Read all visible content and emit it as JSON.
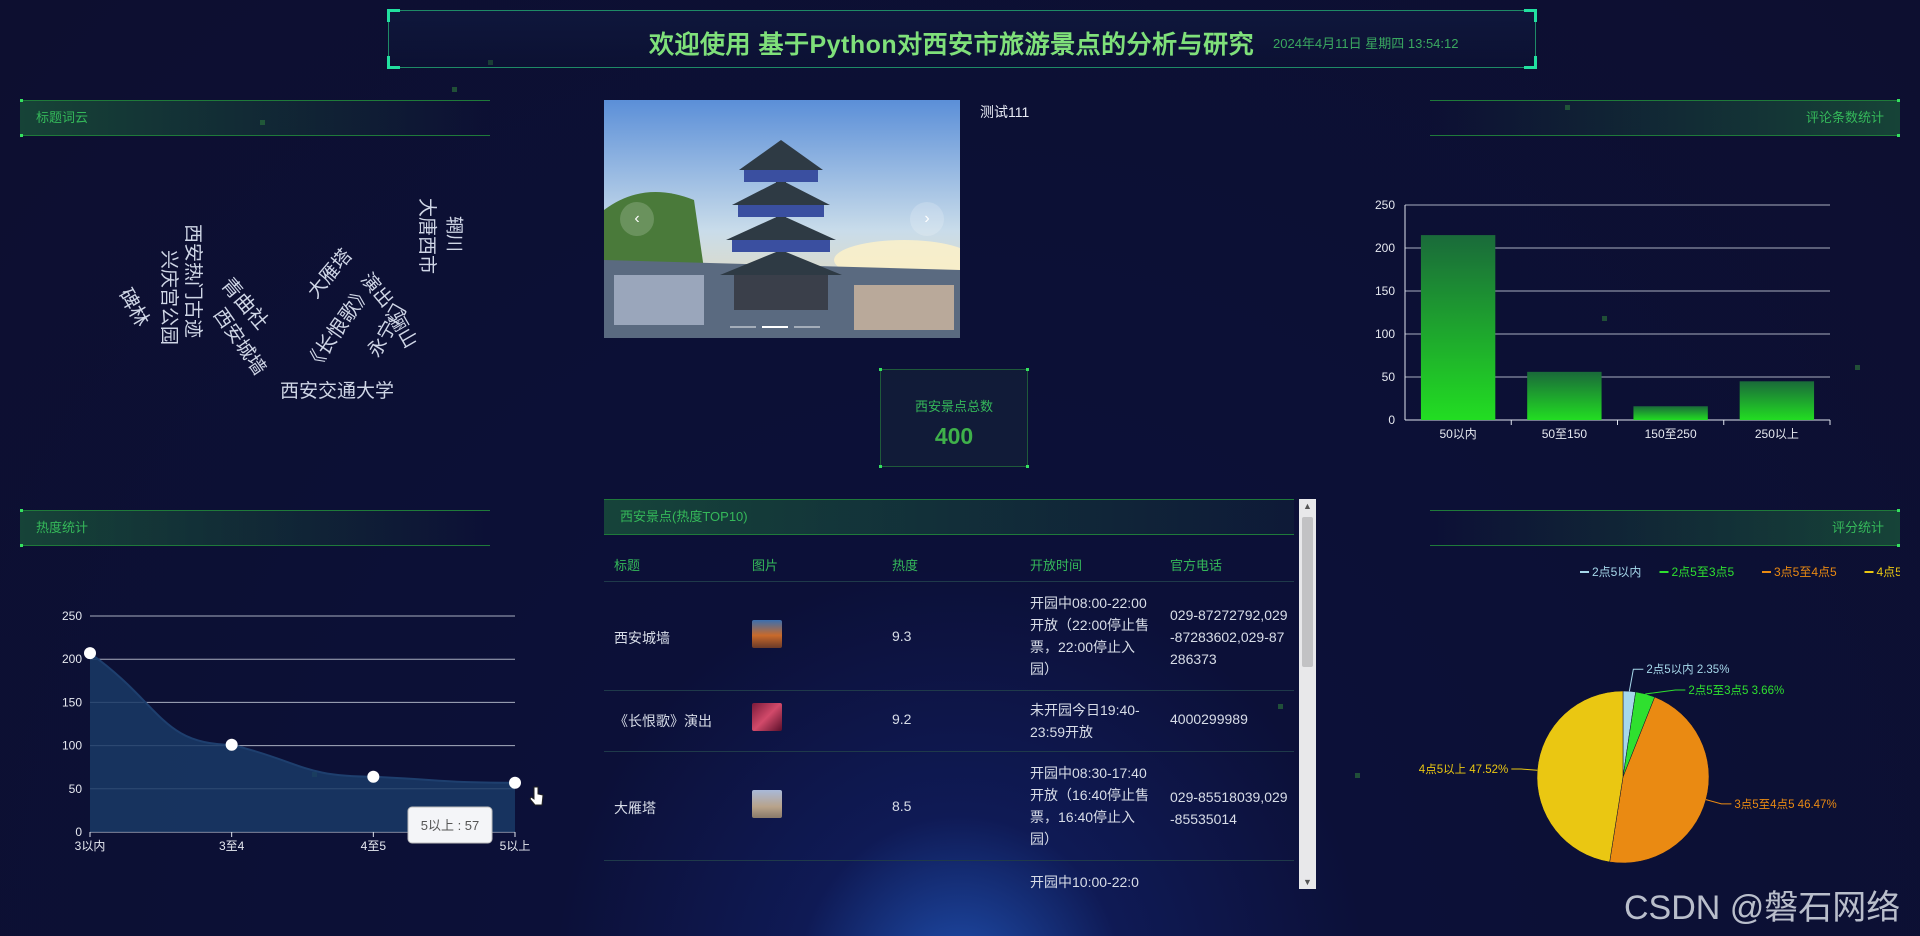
{
  "header": {
    "title": "欢迎使用 基于Python对西安市旅游景点的分析与研究",
    "datetime": "2024年4月11日 星期四 13:54:12"
  },
  "panels": {
    "wordcloud_title": "标题词云",
    "comments_title": "评论条数统计",
    "heat_title": "热度统计",
    "rating_title": "评分统计"
  },
  "wordcloud": {
    "words": [
      {
        "text": "碑林",
        "color": "#e0588f"
      },
      {
        "text": "西安热门古迹",
        "color": "#c9c9c9"
      },
      {
        "text": "兴庆宫公园",
        "color": "#d7c67e"
      },
      {
        "text": "青曲社",
        "color": "#b48ad9"
      },
      {
        "text": "西安城墙",
        "color": "#5fb87a"
      },
      {
        "text": "大雁塔",
        "color": "#8a73d8"
      },
      {
        "text": "《长恨歌》",
        "color": "#e8e8e8"
      },
      {
        "text": "演出",
        "color": "#e8e8e8"
      },
      {
        "text": "永宁门",
        "color": "#4a86c9"
      },
      {
        "text": "骊山",
        "color": "#d7c67e"
      },
      {
        "text": "大唐西市",
        "color": "#9a86e0"
      },
      {
        "text": "辋川",
        "color": "#7fd48a"
      },
      {
        "text": "西安交通大学",
        "color": "#8e9ad8"
      }
    ]
  },
  "carousel": {
    "caption": "测试111",
    "prev_icon": "chevron-left-icon",
    "next_icon": "chevron-right-icon",
    "slide_count": 3,
    "active_index": 1
  },
  "total": {
    "label": "西安景点总数",
    "value": "400"
  },
  "table": {
    "title": "西安景点(热度TOP10)",
    "columns": [
      "标题",
      "图片",
      "热度",
      "开放时间",
      "官方电话"
    ],
    "rows": [
      {
        "title": "西安城墙",
        "image": "city-wall-thumbnail",
        "heat": "9.3",
        "hours": "开园中08:00-22:00开放（22:00停止售票，22:00停止入园）",
        "phone": "029-87272792,029-87283602,029-87286373"
      },
      {
        "title": "《长恨歌》演出",
        "image": "show-thumbnail",
        "heat": "9.2",
        "hours": "未开园今日19:40-23:59开放",
        "phone": "4000299989"
      },
      {
        "title": "大雁塔",
        "image": "pagoda-thumbnail",
        "heat": "8.5",
        "hours": "开园中08:30-17:40开放（16:40停止售票，16:40停止入园）",
        "phone": "029-85518039,029-85535014"
      },
      {
        "title": "",
        "image": "",
        "heat": "",
        "hours": "开园中10:00-22:0",
        "phone": ""
      }
    ]
  },
  "chart_data": [
    {
      "type": "bar",
      "title": "",
      "categories": [
        "50以内",
        "50至150",
        "150至250",
        "250以上"
      ],
      "values": [
        215,
        56,
        16,
        45
      ],
      "ylim": [
        0,
        250
      ],
      "yticks": [
        0,
        50,
        100,
        150,
        200,
        250
      ],
      "grid": true,
      "color": "#22dd22"
    },
    {
      "type": "area",
      "title": "",
      "categories": [
        "3以内",
        "3至4",
        "4至5",
        "5以上"
      ],
      "values": [
        207,
        101,
        64,
        57
      ],
      "ylim": [
        0,
        250
      ],
      "yticks": [
        0,
        50,
        100,
        150,
        200,
        250
      ],
      "grid": true,
      "tooltip": "5以上 : 57"
    },
    {
      "type": "pie",
      "title": "",
      "legend_position": "top-right",
      "slices": [
        {
          "name": "2点5以内",
          "value": 2.35,
          "label": "2点5以内 2.35%",
          "color": "#a6d8ea"
        },
        {
          "name": "2点5至3点5",
          "value": 3.66,
          "label": "2点5至3点5 3.66%",
          "color": "#2fe02f"
        },
        {
          "name": "3点5至4点5",
          "value": 46.47,
          "label": "3点5至4点5 46.47%",
          "color": "#ea8a12"
        },
        {
          "name": "4点5以上",
          "value": 47.52,
          "label": "4点5以上 47.52%",
          "color": "#eac712"
        }
      ]
    }
  ],
  "watermark": "CSDN @磐石网络"
}
